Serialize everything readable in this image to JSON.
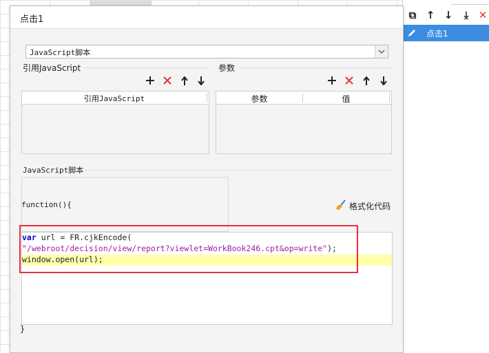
{
  "right_panel": {
    "toolbar": [
      {
        "name": "copy-icon",
        "glyph": "⧉"
      },
      {
        "name": "arrow-up-icon",
        "glyph": "↑"
      },
      {
        "name": "arrow-down-icon",
        "glyph": "↓"
      },
      {
        "name": "move-bottom-icon",
        "glyph": "⤓"
      },
      {
        "name": "delete-icon",
        "glyph": "✕"
      }
    ],
    "selected_item": "点击1"
  },
  "dialog": {
    "title": "点击1",
    "type_select": {
      "value": "JavaScript脚本"
    },
    "js_group": {
      "label": "引用JavaScript",
      "column_header": "引用JavaScript"
    },
    "param_group": {
      "label": "参数",
      "columns": [
        "参数",
        "值"
      ]
    },
    "toolbar_icons": [
      "add-icon",
      "delete-icon",
      "arrow-up-icon",
      "arrow-down-icon"
    ],
    "script_section": {
      "label": "JavaScript脚本",
      "function_header": "function(){",
      "format_button": "格式化代码",
      "closing_brace": "}"
    },
    "code": {
      "line1_keyword": "var",
      "line1_rest": " url = FR.cjkEncode(",
      "line2": "\"/webroot/decision/view/report?viewlet=WorkBook246.cpt&op=write\"",
      "line2_end": ");",
      "line3": "window.open(url);"
    }
  },
  "colors": {
    "accent": "#3a8de0",
    "red": "#e8303a",
    "highlight": "#ffffaa"
  }
}
